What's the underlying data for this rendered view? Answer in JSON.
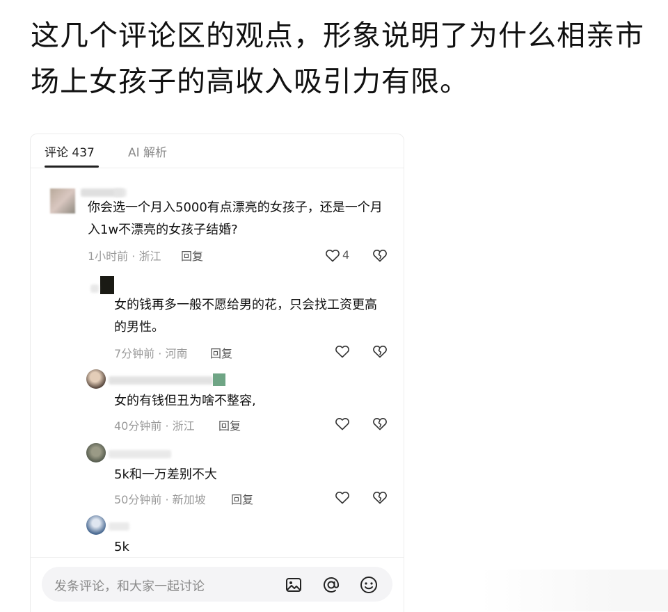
{
  "post": {
    "title": "这几个评论区的观点，形象说明了为什么相亲市场上女孩子的高收入吸引力有限。"
  },
  "tabs": [
    {
      "label": "评论 437"
    },
    {
      "label": "AI 解析"
    }
  ],
  "comments": [
    {
      "text": "你会选一个月入5000有点漂亮的女孩子，还是一个月入1w不漂亮的女孩子结婚?",
      "time_location": "1小时前 · 浙江",
      "reply_label": "回复",
      "likes": "4"
    },
    {
      "text": "女的钱再多一般不愿给男的花，只会找工资更高的男性。",
      "time_location": "7分钟前 · 河南",
      "reply_label": "回复"
    },
    {
      "text": "女的有钱但丑为啥不整容,",
      "time_location": "40分钟前 · 浙江",
      "reply_label": "回复"
    },
    {
      "text": "5k和一万差别不大",
      "time_location": "50分钟前 · 新加坡",
      "reply_label": "回复"
    },
    {
      "text": "5k"
    }
  ],
  "input": {
    "placeholder": "发条评论，和大家一起讨论"
  },
  "icons": [
    "heart-icon",
    "broken-heart-icon",
    "image-icon",
    "at-icon",
    "emoji-icon"
  ],
  "colors": {
    "text": "#111111",
    "meta": "#9a9a9a",
    "icon": "#333333"
  }
}
